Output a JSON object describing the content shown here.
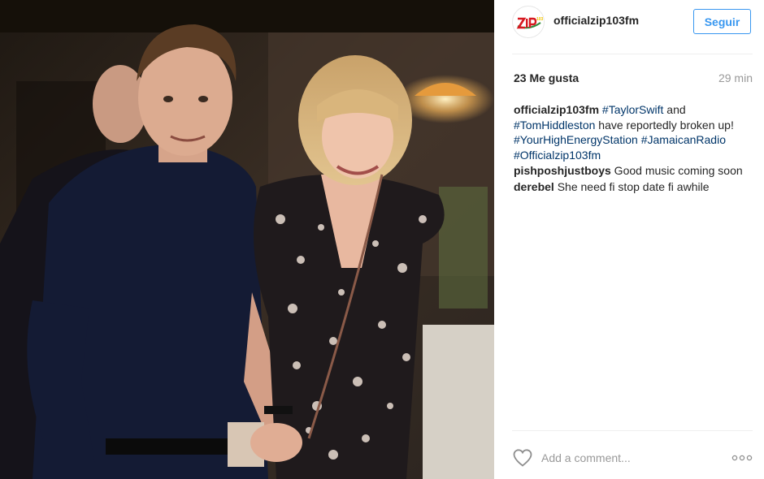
{
  "post": {
    "username": "officialzip103fm",
    "follow_label": "Seguir",
    "likes": "23 Me gusta",
    "time": "29 min",
    "caption": {
      "user": "officialzip103fm",
      "pre": "",
      "tag1": "#TaylorSwift",
      "mid1": " and ",
      "tag2": "#TomHiddleston",
      "mid2": " have reportedly broken up! ",
      "tag3": "#YourHighEnergyStation",
      "mid3": " ",
      "tag4": "#JamaicanRadio",
      "mid4": " ",
      "tag5": "#Officialzip103fm"
    },
    "comments": [
      {
        "user": "pishposhjustboys",
        "text": " Good music coming soon"
      },
      {
        "user": "derebel",
        "text": " She need fi stop date fi awhile"
      }
    ],
    "comment_placeholder": "Add a comment...",
    "avatar_logo": "ZIP103",
    "icons": {
      "like": "heart-icon",
      "more": "more-options-icon"
    }
  },
  "colors": {
    "follow_blue": "#3897f0",
    "hashtag": "#003569",
    "muted": "#999999"
  }
}
